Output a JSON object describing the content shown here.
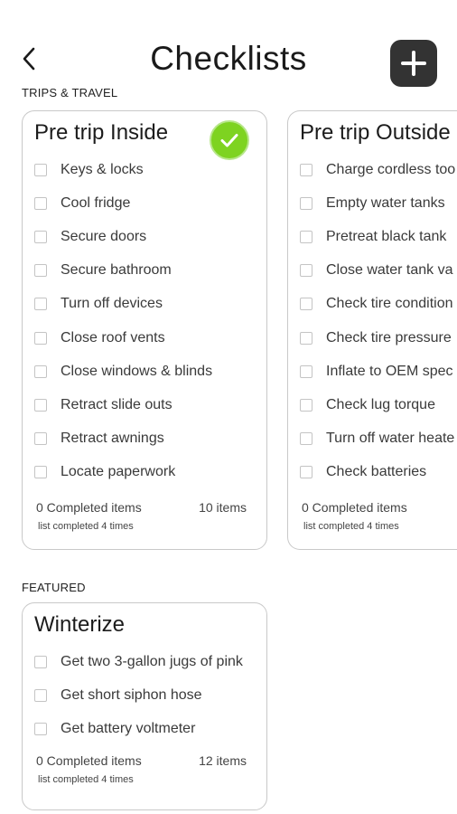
{
  "header": {
    "title": "Checklists",
    "back_icon": "chevron-left-icon",
    "add_icon": "plus-icon"
  },
  "sections": {
    "trips": "TRIPS & TRAVEL",
    "featured": "FEATURED"
  },
  "cards": {
    "pre_trip_inside": {
      "title": "Pre trip Inside",
      "completed_badge": "check-circle-icon",
      "items": [
        {
          "label": "Keys & locks"
        },
        {
          "label": "Cool fridge"
        },
        {
          "label": "Secure doors"
        },
        {
          "label": "Secure bathroom"
        },
        {
          "label": "Turn off devices"
        },
        {
          "label": "Close roof vents"
        },
        {
          "label": "Close windows & blinds"
        },
        {
          "label": "Retract slide outs"
        },
        {
          "label": "Retract awnings"
        },
        {
          "label": "Locate paperwork"
        }
      ],
      "completed_text": "0 Completed items",
      "count_text": "10 items",
      "times_text": "list completed 4 times"
    },
    "pre_trip_outside": {
      "title": "Pre trip Outside",
      "items": [
        {
          "label": "Charge cordless too"
        },
        {
          "label": "Empty water tanks"
        },
        {
          "label": "Pretreat black tank"
        },
        {
          "label": "Close water tank va"
        },
        {
          "label": "Check tire condition"
        },
        {
          "label": "Check tire pressure"
        },
        {
          "label": "Inflate to OEM spec"
        },
        {
          "label": "Check lug torque"
        },
        {
          "label": "Turn off water heate"
        },
        {
          "label": "Check batteries"
        }
      ],
      "completed_text": "0 Completed items",
      "times_text": "list completed 4 times"
    },
    "winterize": {
      "title": "Winterize",
      "items": [
        {
          "label": "Get two 3-gallon jugs of pink"
        },
        {
          "label": "Get short siphon hose"
        },
        {
          "label": "Get battery voltmeter"
        }
      ],
      "completed_text": "0 Completed items",
      "count_text": "12 items",
      "times_text": "list completed 4 times"
    }
  },
  "colors": {
    "add_button_bg": "#333333",
    "check_badge": "#7ed321",
    "card_border": "#c9c9c9"
  }
}
